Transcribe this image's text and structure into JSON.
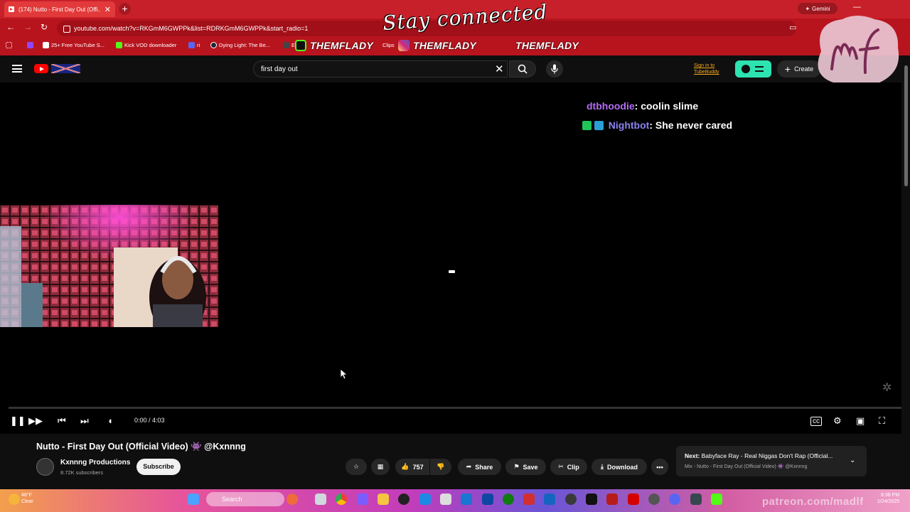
{
  "browser": {
    "tab_title": "(174) Nutto - First Day Out (Offi...",
    "tab_close": "✕",
    "new_tab": "+",
    "url": "youtube.com/watch?v=RKGmM6GWPPk&list=RDRKGmM6GWPPk&start_radio=1",
    "gemini_label": "Gemini",
    "bookmarks": [
      {
        "label": "25+ Free YouTube S...",
        "color": "#ffffff"
      },
      {
        "label": "Kick VOD downloader",
        "color": "#53fc18"
      },
      {
        "label": "ri",
        "color": "#5865f2"
      },
      {
        "label": "Dying Light: The Be...",
        "color": "#1b2838"
      },
      {
        "label": "En",
        "color": "#9146ff"
      },
      {
        "label": "Clips",
        "color": "#9146ff"
      }
    ],
    "overlay_socials": [
      "THEMFLADY",
      "THEMFLADY",
      "THEMFLADY"
    ],
    "overlay_headline": "Stay connected"
  },
  "youtube": {
    "search_value": "first day out",
    "tubebuddy_link": "Sign in to TubeBuddy",
    "create_label": "Create"
  },
  "video": {
    "chat": [
      {
        "user": "dtbhoodie",
        "message": ": coolin slime",
        "color": "#b36cf5"
      },
      {
        "user": "Nightbot",
        "message": ": She never cared",
        "color": "#8a82f0"
      }
    ],
    "timecode": "0:00 / 4:03"
  },
  "details": {
    "title": "Nutto - First Day Out (Official Video) 👾 @Kxnnng",
    "channel": "Kxnnng Productions",
    "subscribers": "8.72K subscribers",
    "subscribe_label": "Subscribe",
    "likes": "757",
    "share_label": "Share",
    "save_label": "Save",
    "clip_label": "Clip",
    "download_label": "Download",
    "next_prefix": "Next:",
    "next_title": "Babyface Ray - Real Niggas Don't Rap (Official...",
    "next_sub": "Mix - Nutto - First Day Out (Official Video) 👾 @Kxnnng"
  },
  "taskbar": {
    "search_label": "Search",
    "weather_temp": "48°F",
    "weather_desc": "Clear",
    "time": "8:38 PM",
    "date": "1/24/2025",
    "watermark": "patreon.com/madlf"
  },
  "colors": {
    "chrome_red": "#c8202a",
    "yt_bg": "#0f0f0f",
    "tubebuddy_green": "#2de3b0"
  }
}
